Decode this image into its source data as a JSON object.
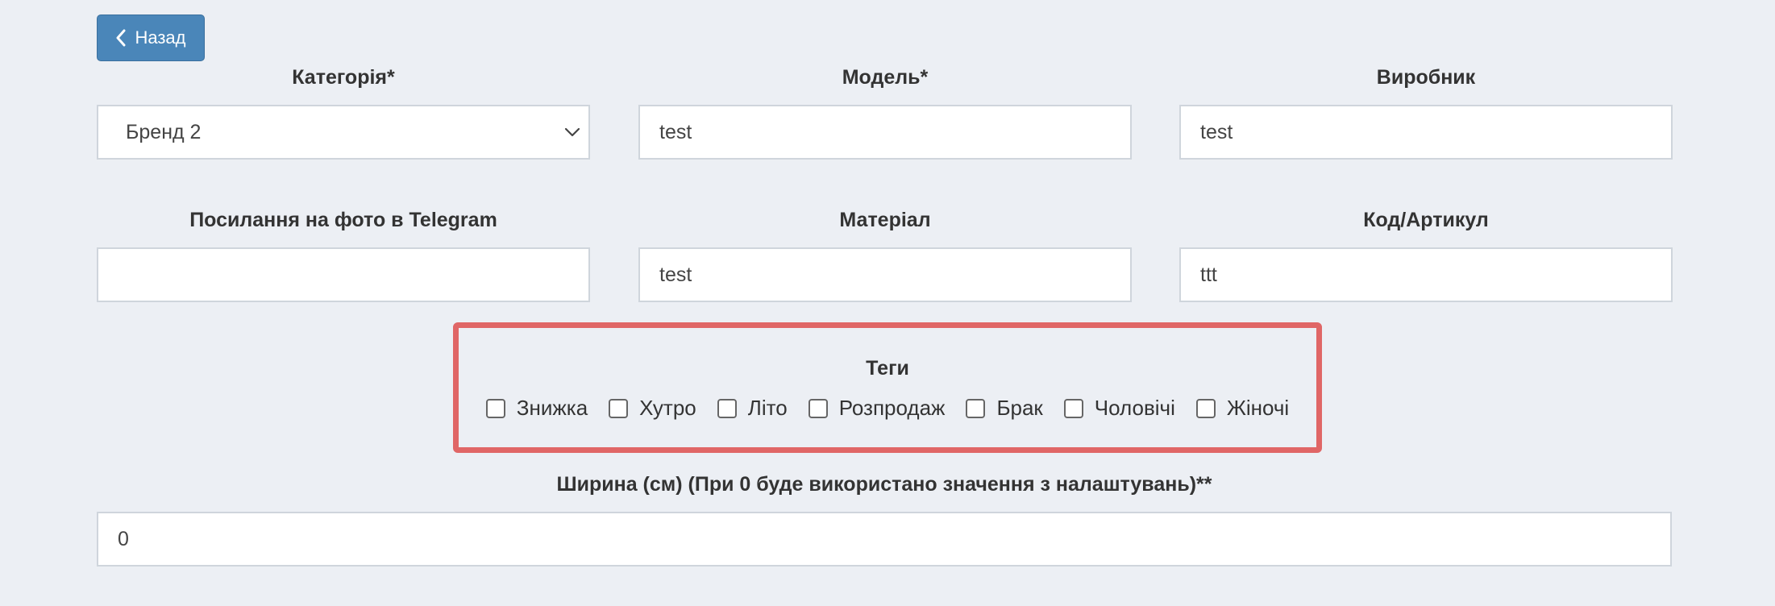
{
  "back_button": {
    "label": "Назад"
  },
  "fields": {
    "category": {
      "label": "Категорія*",
      "value": "Бренд 2"
    },
    "model": {
      "label": "Модель*",
      "value": "test"
    },
    "manufacturer": {
      "label": "Виробник",
      "value": "test"
    },
    "telegram_photo": {
      "label": "Посилання на фото в Telegram",
      "value": ""
    },
    "material": {
      "label": "Матеріал",
      "value": "test"
    },
    "code": {
      "label": "Код/Артикул",
      "value": "ttt"
    },
    "width": {
      "label": "Ширина (см) (При 0 буде використано значення з налаштувань)**",
      "value": "0"
    }
  },
  "tags": {
    "title": "Теги",
    "items": [
      {
        "label": "Знижка",
        "checked": false
      },
      {
        "label": "Хутро",
        "checked": false
      },
      {
        "label": "Літо",
        "checked": false
      },
      {
        "label": "Розпродаж",
        "checked": false
      },
      {
        "label": "Брак",
        "checked": false
      },
      {
        "label": "Чоловічі",
        "checked": false
      },
      {
        "label": "Жіночі",
        "checked": false
      }
    ]
  },
  "colors": {
    "background": "#eceff4",
    "back_button": "#4a86b9",
    "highlight_border": "#e06666"
  },
  "icons": {
    "back": "chevron-left-icon",
    "dropdown": "chevron-down-icon"
  }
}
